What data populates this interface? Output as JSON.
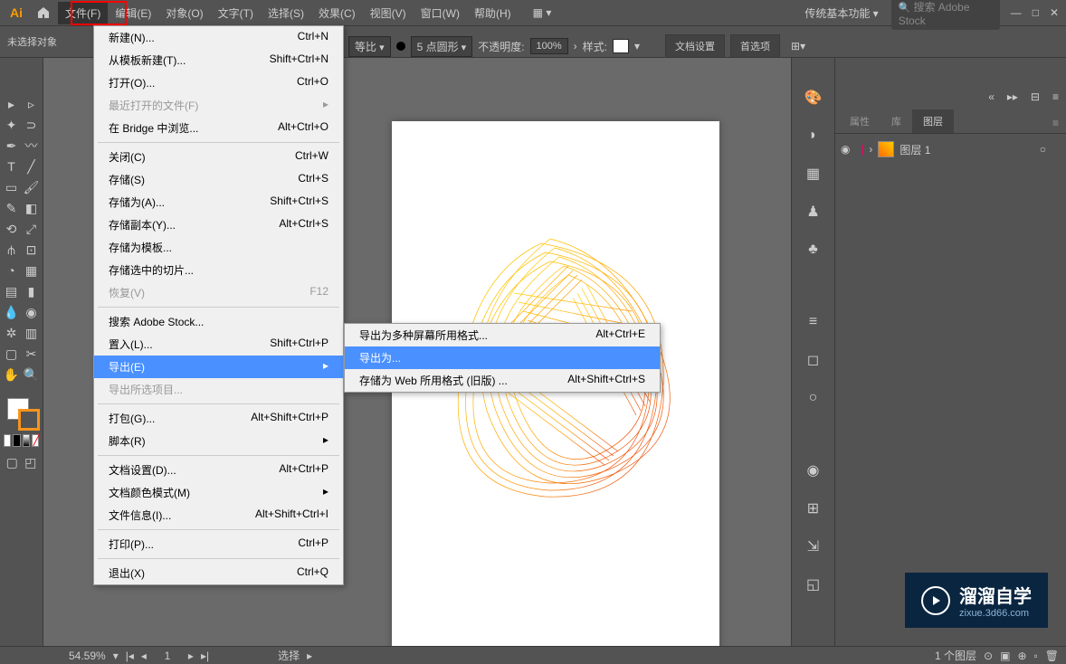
{
  "menubar": {
    "items": [
      "文件(F)",
      "编辑(E)",
      "对象(O)",
      "文字(T)",
      "选择(S)",
      "效果(C)",
      "视图(V)",
      "窗口(W)",
      "帮助(H)"
    ],
    "workspace": "传统基本功能",
    "search_placeholder": "搜索 Adobe Stock"
  },
  "toolbar": {
    "no_selection": "未选择对象",
    "stroke_style": "等比",
    "stroke_val": "5 点圆形",
    "opacity_label": "不透明度:",
    "opacity_val": "100%",
    "style_label": "样式:",
    "doc_setup": "文档设置",
    "prefs": "首选项"
  },
  "file_menu": [
    {
      "label": "新建(N)...",
      "shortcut": "Ctrl+N"
    },
    {
      "label": "从模板新建(T)...",
      "shortcut": "Shift+Ctrl+N"
    },
    {
      "label": "打开(O)...",
      "shortcut": "Ctrl+O"
    },
    {
      "label": "最近打开的文件(F)",
      "shortcut": "",
      "disabled": true,
      "arrow": true
    },
    {
      "label": "在 Bridge 中浏览...",
      "shortcut": "Alt+Ctrl+O"
    },
    {
      "sep": true
    },
    {
      "label": "关闭(C)",
      "shortcut": "Ctrl+W"
    },
    {
      "label": "存储(S)",
      "shortcut": "Ctrl+S"
    },
    {
      "label": "存储为(A)...",
      "shortcut": "Shift+Ctrl+S"
    },
    {
      "label": "存储副本(Y)...",
      "shortcut": "Alt+Ctrl+S"
    },
    {
      "label": "存储为模板...",
      "shortcut": ""
    },
    {
      "label": "存储选中的切片...",
      "shortcut": ""
    },
    {
      "label": "恢复(V)",
      "shortcut": "F12",
      "disabled": true
    },
    {
      "sep": true
    },
    {
      "label": "搜索 Adobe Stock...",
      "shortcut": ""
    },
    {
      "label": "置入(L)...",
      "shortcut": "Shift+Ctrl+P"
    },
    {
      "label": "导出(E)",
      "shortcut": "",
      "arrow": true,
      "highlighted": true
    },
    {
      "label": "导出所选项目...",
      "shortcut": "",
      "disabled": true
    },
    {
      "sep": true
    },
    {
      "label": "打包(G)...",
      "shortcut": "Alt+Shift+Ctrl+P"
    },
    {
      "label": "脚本(R)",
      "shortcut": "",
      "arrow": true
    },
    {
      "sep": true
    },
    {
      "label": "文档设置(D)...",
      "shortcut": "Alt+Ctrl+P"
    },
    {
      "label": "文档颜色模式(M)",
      "shortcut": "",
      "arrow": true
    },
    {
      "label": "文件信息(I)...",
      "shortcut": "Alt+Shift+Ctrl+I"
    },
    {
      "sep": true
    },
    {
      "label": "打印(P)...",
      "shortcut": "Ctrl+P"
    },
    {
      "sep": true
    },
    {
      "label": "退出(X)",
      "shortcut": "Ctrl+Q"
    }
  ],
  "export_submenu": [
    {
      "label": "导出为多种屏幕所用格式...",
      "shortcut": "Alt+Ctrl+E"
    },
    {
      "label": "导出为...",
      "shortcut": "",
      "highlighted": true
    },
    {
      "label": "存储为 Web 所用格式 (旧版) ...",
      "shortcut": "Alt+Shift+Ctrl+S"
    }
  ],
  "panels": {
    "tabs": [
      "属性",
      "库",
      "图层"
    ],
    "layer_name": "图层 1"
  },
  "statusbar": {
    "zoom": "54.59%",
    "select_label": "选择",
    "layer_count": "1 个图层"
  },
  "watermark": {
    "title": "溜溜自学",
    "url": "zixue.3d66.com"
  }
}
